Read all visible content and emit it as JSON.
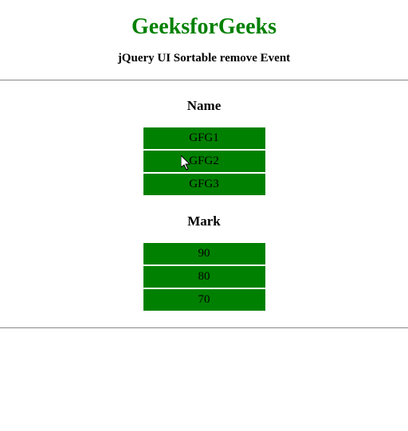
{
  "header": {
    "title": "GeeksforGeeks",
    "subtitle": "jQuery UI Sortable remove Event"
  },
  "list1": {
    "heading": "Name",
    "items": [
      "GFG1",
      "GFG2",
      "GFG3"
    ]
  },
  "list2": {
    "heading": "Mark",
    "items": [
      "90",
      "80",
      "70"
    ]
  }
}
